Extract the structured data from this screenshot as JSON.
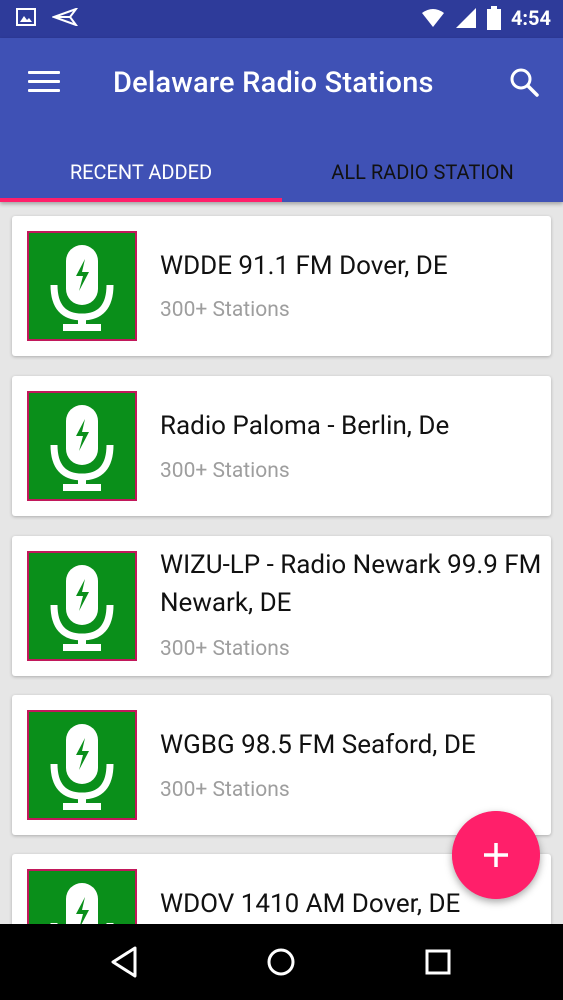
{
  "status_bar": {
    "time": "4:54"
  },
  "app_bar": {
    "title": "Delaware Radio Stations"
  },
  "tabs": [
    {
      "label": "RECENT ADDED"
    },
    {
      "label": "ALL RADIO STATION"
    }
  ],
  "stations": [
    {
      "name": "WDDE 91.1 FM Dover, DE",
      "sub": "300+ Stations"
    },
    {
      "name": "Radio Paloma - Berlin, De",
      "sub": "300+ Stations"
    },
    {
      "name": "WIZU-LP - Radio Newark 99.9 FM Newark, DE",
      "sub": "300+ Stations"
    },
    {
      "name": "WGBG 98.5 FM Seaford, DE",
      "sub": "300+ Stations"
    },
    {
      "name": "WDOV 1410 AM Dover, DE",
      "sub": ""
    }
  ],
  "fab": {
    "icon": "plus-icon"
  },
  "colors": {
    "primary": "#3f51b5",
    "status": "#2e3b9a",
    "accent": "#ff1f6a",
    "thumb_green": "#0a8f1a"
  }
}
